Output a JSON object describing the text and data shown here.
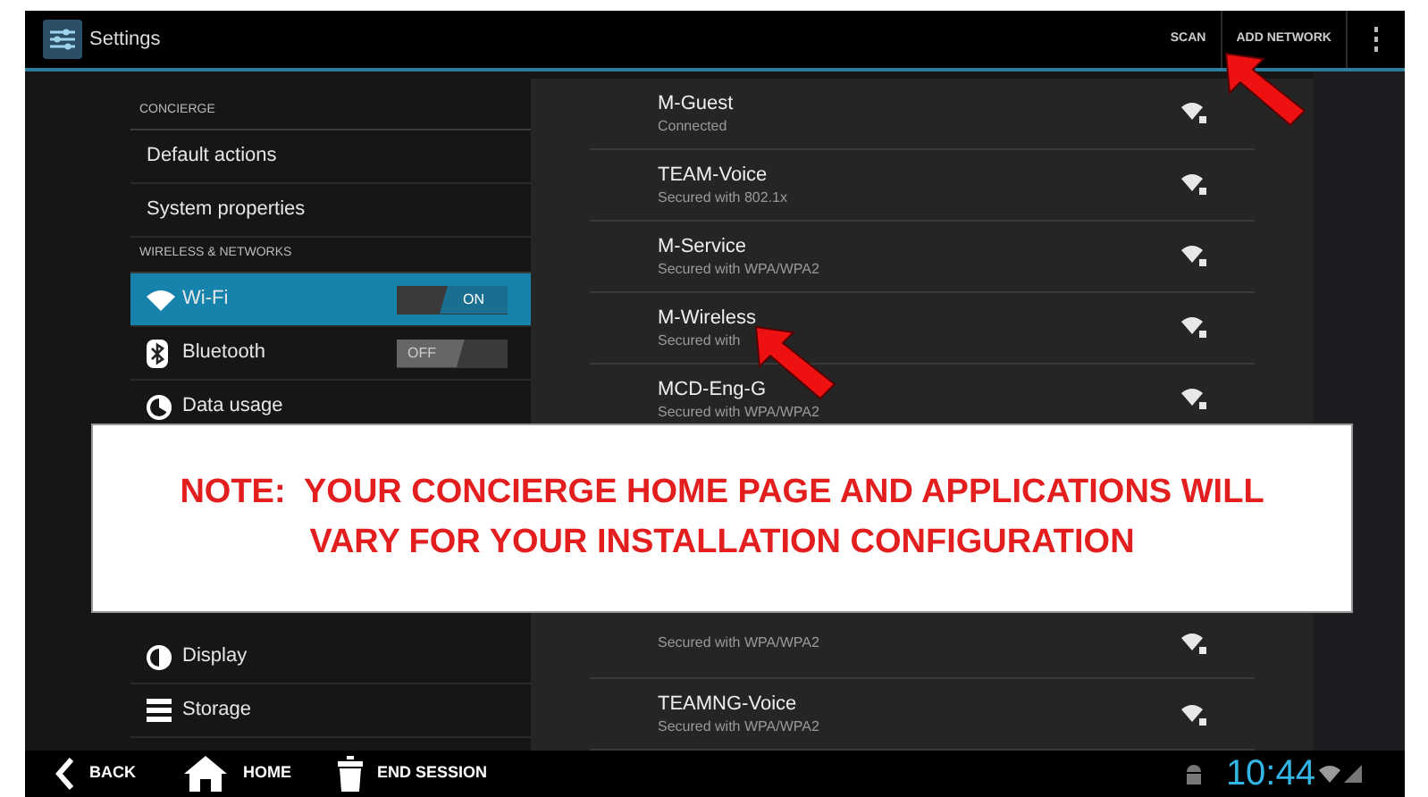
{
  "action_bar": {
    "title": "Settings",
    "actions": [
      "SCAN",
      "ADD NETWORK"
    ]
  },
  "sidebar": {
    "sections": [
      {
        "header": "CONCIERGE",
        "items": [
          {
            "label": "Default actions",
            "kind": "none",
            "selected": false
          },
          {
            "label": "System properties",
            "kind": "none",
            "selected": false
          }
        ]
      },
      {
        "header": "WIRELESS & NETWORKS",
        "items": [
          {
            "label": "Wi-Fi",
            "kind": "wifi",
            "selected": true,
            "toggle": {
              "on": true,
              "label": "ON"
            }
          },
          {
            "label": "Bluetooth",
            "kind": "bluetooth",
            "selected": false,
            "toggle": {
              "on": false,
              "label": "OFF"
            }
          },
          {
            "label": "Data usage",
            "kind": "data",
            "selected": false
          }
        ]
      }
    ],
    "lower_items": [
      {
        "label": "Display",
        "kind": "display",
        "selected": false
      },
      {
        "label": "Storage",
        "kind": "storage",
        "selected": false
      }
    ]
  },
  "networks": {
    "upper": [
      {
        "name": "M-Guest",
        "status": "Connected"
      },
      {
        "name": "TEAM-Voice",
        "status": "Secured with 802.1x"
      },
      {
        "name": "M-Service",
        "status": "Secured with WPA/WPA2"
      },
      {
        "name": "M-Wireless",
        "status": "Secured with"
      },
      {
        "name": "MCD-Eng-G",
        "status": "Secured with WPA/WPA2"
      }
    ],
    "lower": [
      {
        "status": "Secured with WPA/WPA2"
      },
      {
        "name": "TEAMNG-Voice",
        "status": "Secured with WPA/WPA2"
      }
    ]
  },
  "note": {
    "lines": [
      "NOTE:  YOUR CONCIERGE HOME PAGE AND APPLICATIONS WILL",
      "VARY FOR YOUR INSTALLATION CONFIGURATION"
    ]
  },
  "bottom_bar": {
    "nav": [
      {
        "label": "BACK",
        "kind": "back"
      },
      {
        "label": "HOME",
        "kind": "home"
      },
      {
        "label": "END SESSION",
        "kind": "trash"
      }
    ],
    "clock": "10:44"
  }
}
